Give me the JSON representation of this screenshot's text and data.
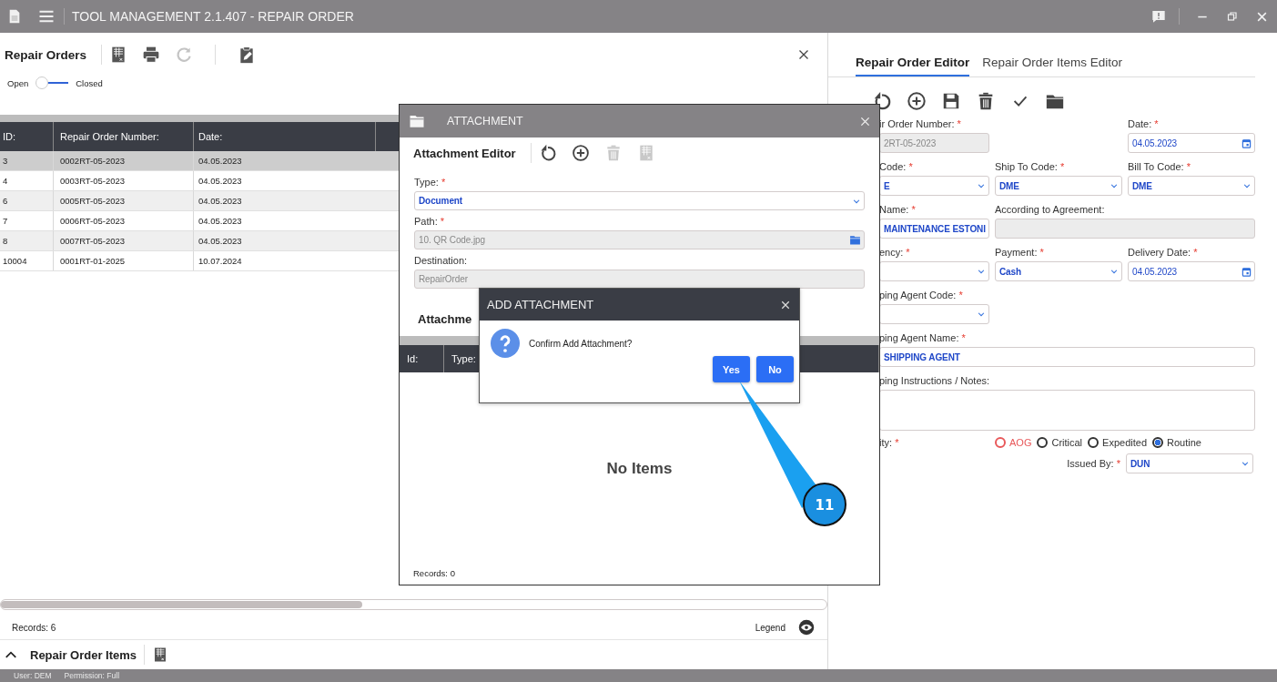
{
  "window": {
    "title": "TOOL MANAGEMENT 2.1.407 - REPAIR ORDER"
  },
  "left_panel": {
    "title": "Repair Orders",
    "tools": [
      {
        "kind": "excel",
        "disabled": false
      },
      {
        "kind": "print",
        "disabled": false
      },
      {
        "kind": "refresh",
        "disabled": true
      },
      {
        "kind": "clipboard",
        "disabled": false
      }
    ],
    "toggle": {
      "left_label": "Open",
      "right_label": "Closed",
      "checked": false
    },
    "table": {
      "columns": [
        "ID:",
        "Repair Order Number:",
        "Date:"
      ],
      "rows": [
        {
          "cells": [
            "3",
            "0002RT-05-2023",
            "04.05.2023"
          ],
          "selected": true
        },
        {
          "cells": [
            "4",
            "0003RT-05-2023",
            "04.05.2023"
          ],
          "selected": false
        },
        {
          "cells": [
            "6",
            "0005RT-05-2023",
            "04.05.2023"
          ],
          "selected": false
        },
        {
          "cells": [
            "7",
            "0006RT-05-2023",
            "04.05.2023"
          ],
          "selected": false
        },
        {
          "cells": [
            "8",
            "0007RT-05-2023",
            "04.05.2023"
          ],
          "selected": false
        },
        {
          "cells": [
            "10004",
            "0001RT-01-2025",
            "10.07.2024"
          ],
          "selected": false
        }
      ]
    },
    "records": "Records: 6",
    "legend": "Legend",
    "items_section": {
      "title": "Repair Order Items",
      "expanded": true
    }
  },
  "right_panel": {
    "tabs": [
      {
        "label": "Repair Order Editor",
        "selected": true
      },
      {
        "label": "Repair Order Items Editor",
        "selected": false
      }
    ],
    "tools": [
      {
        "kind": "undo",
        "disabled": false
      },
      {
        "kind": "add",
        "disabled": false
      },
      {
        "kind": "save",
        "disabled": false
      },
      {
        "kind": "delete",
        "disabled": false
      },
      {
        "kind": "check",
        "disabled": false
      },
      {
        "kind": "folder",
        "disabled": false
      }
    ],
    "rows": [
      {
        "kind": "first_and_last",
        "fields": [
          {
            "label": "ir Order Number:",
            "mark": "*",
            "kind": "readonly",
            "value": "2RT-05-2023"
          },
          {
            "label": "Date:",
            "mark": "*",
            "kind": "date",
            "value": "04.05.2023"
          }
        ]
      },
      {
        "kind": "three",
        "fields": [
          {
            "label": "Code:",
            "mark": "*",
            "kind": "select",
            "value": "E"
          },
          {
            "label": "Ship To Code:",
            "mark": "*",
            "kind": "select",
            "value": "DME"
          },
          {
            "label": "Bill To Code:",
            "mark": "*",
            "kind": "select",
            "value": "DME"
          }
        ]
      },
      {
        "kind": "first_and_wide",
        "fields": [
          {
            "label": "Name:",
            "mark": "*",
            "kind": "input",
            "value": "MAINTENANCE ESTONI"
          },
          {
            "label": "According to Agreement:",
            "kind": "readonly"
          }
        ]
      },
      {
        "kind": "three",
        "fields": [
          {
            "label": "ency:",
            "mark": "*",
            "kind": "select"
          },
          {
            "label": "Payment:",
            "mark": "*",
            "kind": "select",
            "value": "Cash"
          },
          {
            "label": "Delivery Date:",
            "mark": "*",
            "kind": "date",
            "value": "04.05.2023"
          }
        ]
      },
      {
        "kind": "first",
        "fields": [
          {
            "label": "ping Agent Code:",
            "mark": "*",
            "kind": "select"
          }
        ]
      },
      {
        "kind": "full",
        "fields": [
          {
            "label": "ping Agent Name:",
            "mark": "*",
            "kind": "input",
            "value": "SHIPPING AGENT"
          }
        ]
      },
      {
        "kind": "full",
        "fields": [
          {
            "label": "ping Instructions / Notes:",
            "kind": "textarea"
          }
        ]
      }
    ],
    "priority": {
      "label": "ity:",
      "mark": "*",
      "options": [
        {
          "label": "AOG",
          "selected": false,
          "color": "#e8585a"
        },
        {
          "label": "Critical",
          "selected": false,
          "color": "#333333"
        },
        {
          "label": "Expedited",
          "selected": false,
          "color": "#333333"
        },
        {
          "label": "Routine",
          "selected": true,
          "color": "#333333"
        }
      ]
    },
    "issued_by": {
      "label": "Issued By:",
      "mark": "*",
      "value": "DUN"
    }
  },
  "attachment_dialog": {
    "title": "ATTACHMENT",
    "editor_title": "Attachment Editor",
    "tools": [
      {
        "kind": "undo",
        "disabled": false
      },
      {
        "kind": "add",
        "disabled": false
      },
      {
        "kind": "delete",
        "disabled": true
      },
      {
        "kind": "excel",
        "disabled": true
      }
    ],
    "fields": [
      {
        "label": "Type:",
        "mark": "*",
        "kind": "select",
        "value": "Document"
      },
      {
        "label": "Path:",
        "mark": "*",
        "kind": "file",
        "value": "10. QR Code.jpg"
      },
      {
        "label": "Destination:",
        "kind": "readonly",
        "value": "RepairOrder"
      }
    ],
    "section_title": "Attachme",
    "columns": [
      "Id:",
      "Type:"
    ],
    "empty": "No Items",
    "records": "Records: 0"
  },
  "confirm_dialog": {
    "title": "ADD ATTACHMENT",
    "message": "Confirm Add Attachment?",
    "buttons": [
      "Yes",
      "No"
    ]
  },
  "callout": {
    "label": "11"
  },
  "status_bar": {
    "items": [
      "User: DEM",
      "Permission: Full"
    ]
  }
}
